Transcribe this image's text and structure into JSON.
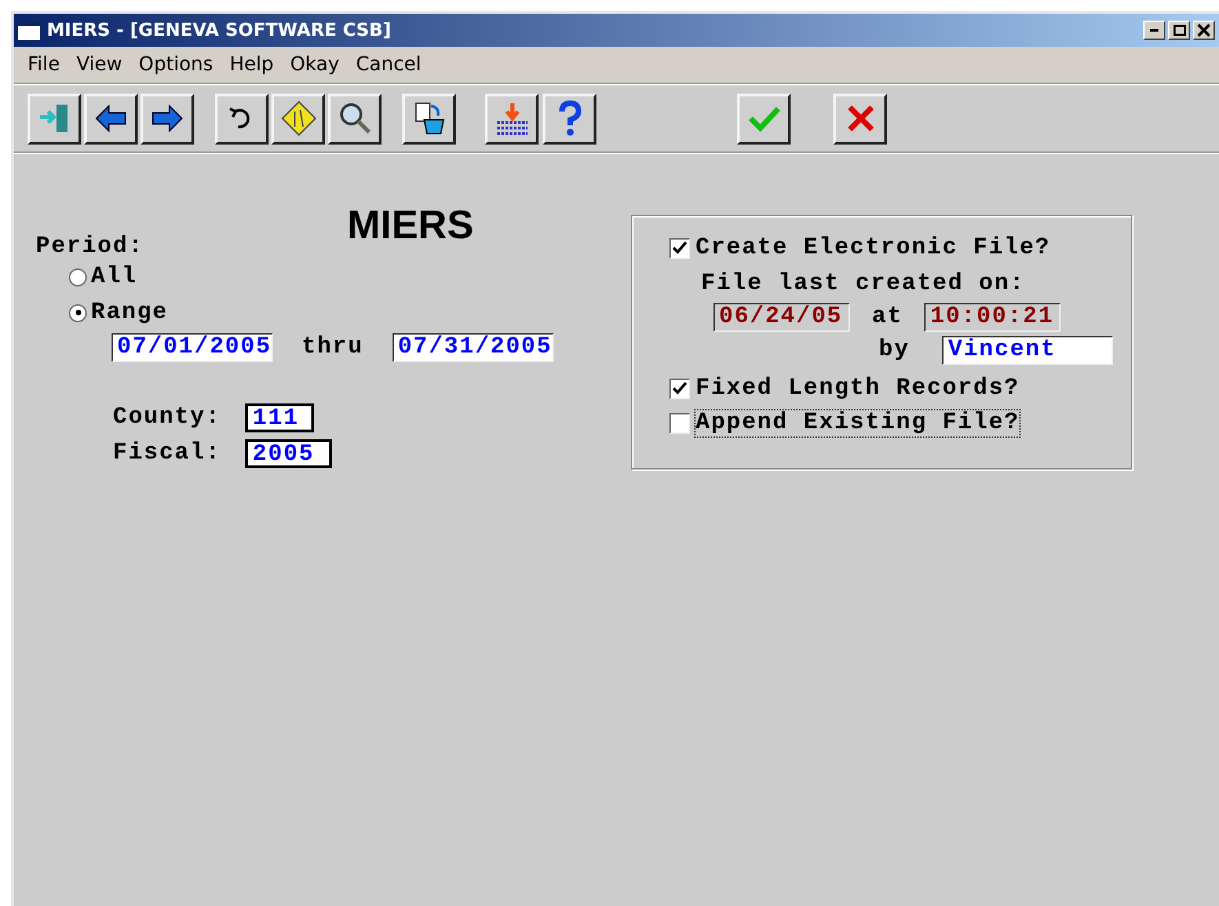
{
  "window": {
    "title": "MIERS - [GENEVA SOFTWARE CSB]"
  },
  "menu": [
    "File",
    "View",
    "Options",
    "Help",
    "Okay",
    "Cancel"
  ],
  "form_title": "MIERS",
  "period": {
    "label": "Period:",
    "options": [
      {
        "label": "All",
        "selected": false
      },
      {
        "label": "Range",
        "selected": true
      }
    ],
    "from": "07/01/2005",
    "thru_label": "thru",
    "to": "07/31/2005"
  },
  "county": {
    "label": "County:",
    "value": "111"
  },
  "fiscal": {
    "label": "Fiscal:",
    "value": "2005"
  },
  "electronic": {
    "create": {
      "label": "Create Electronic File?",
      "checked": true
    },
    "last_created_label": "File last created on:",
    "date": {
      "value": "06/24/05",
      "readonly": true
    },
    "at_label": "at",
    "time": {
      "value": "10:00:21",
      "readonly": true
    },
    "by_label": "by",
    "user": {
      "value": "Vincent",
      "readonly": false
    },
    "fixed": {
      "label": "Fixed Length Records?",
      "checked": true
    },
    "append": {
      "label": "Append Existing File?",
      "checked": false,
      "focused": true
    }
  }
}
